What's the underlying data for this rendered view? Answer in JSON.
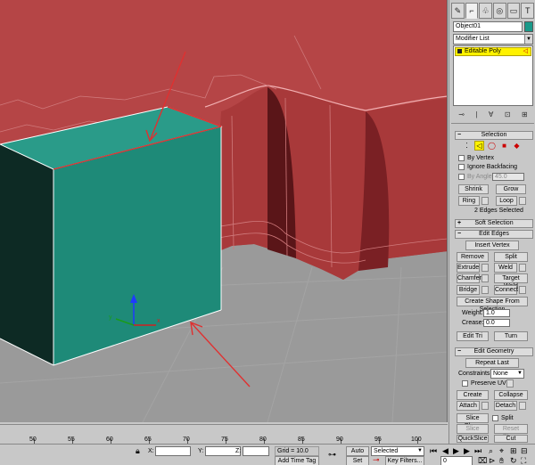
{
  "command_panel": {
    "tabs": [
      {
        "icon": "create-icon",
        "glyph": "✎"
      },
      {
        "icon": "modify-icon",
        "glyph": "⌐"
      },
      {
        "icon": "hierarchy-icon",
        "glyph": "♧"
      },
      {
        "icon": "motion-icon",
        "glyph": "◎"
      },
      {
        "icon": "display-icon",
        "glyph": "▭"
      },
      {
        "icon": "utilities-icon",
        "glyph": "T"
      }
    ],
    "object_name": "Object01",
    "object_color": "#1a9a8a",
    "modifier_list": "Modifier List",
    "stack_item": "Editable Poly",
    "stack_tools": [
      "⊸",
      "|",
      "∀",
      "⊡",
      "⊞"
    ]
  },
  "selection": {
    "title": "Selection",
    "by_vertex": "By Vertex",
    "ignore_backfacing": "Ignore Backfacing",
    "by_angle": "By Angle:",
    "angle_value": "45.0",
    "shrink": "Shrink",
    "grow": "Grow",
    "ring": "Ring",
    "loop": "Loop",
    "status": "2 Edges Selected"
  },
  "soft_selection": {
    "title": "Soft Selection"
  },
  "edit_edges": {
    "title": "Edit Edges",
    "insert_vertex": "Insert Vertex",
    "remove": "Remove",
    "split": "Split",
    "extrude": "Extrude",
    "weld": "Weld",
    "chamfer": "Chamfer",
    "target_weld": "Target Weld",
    "bridge": "Bridge",
    "connect": "Connect",
    "create_shape": "Create Shape From Selection",
    "weight_label": "Weight:",
    "weight_value": "1.0",
    "crease_label": "Crease:",
    "crease_value": "0.0",
    "edit_tri": "Edit Tri",
    "turn": "Turn"
  },
  "edit_geometry": {
    "title": "Edit Geometry",
    "repeat_last": "Repeat Last",
    "constraints_label": "Constraints:",
    "constraints_value": "None",
    "preserve_uvs": "Preserve UVs",
    "create": "Create",
    "collapse": "Collapse",
    "attach": "Attach",
    "detach": "Detach",
    "slice_plane": "Slice Plane",
    "split": "Split",
    "slice": "Slice",
    "reset_plane": "Reset Plane",
    "quickslice": "QuickSlice",
    "cut": "Cut"
  },
  "timeline": {
    "ticks": [
      "50",
      "55",
      "60",
      "65",
      "70",
      "75",
      "80",
      "85",
      "90",
      "95",
      "100"
    ]
  },
  "status_bar": {
    "x_label": "X:",
    "y_label": "Y:",
    "z_label": "Z:",
    "grid": "Grid = 10.0",
    "add_time_tag": "Add Time Tag",
    "auto_key": "Auto Key",
    "auto_key_value": "Selected",
    "set_key": "Set Key",
    "key_filters": "Key Filters...",
    "frame": "0"
  },
  "colors": {
    "wall": "#b54546",
    "box_front": "#1e8a78",
    "box_top": "#2a9b89",
    "box_side": "#0d2a24",
    "floor": "#9a9a9a",
    "highlight": "#fff200",
    "arrow": "#e03030"
  }
}
